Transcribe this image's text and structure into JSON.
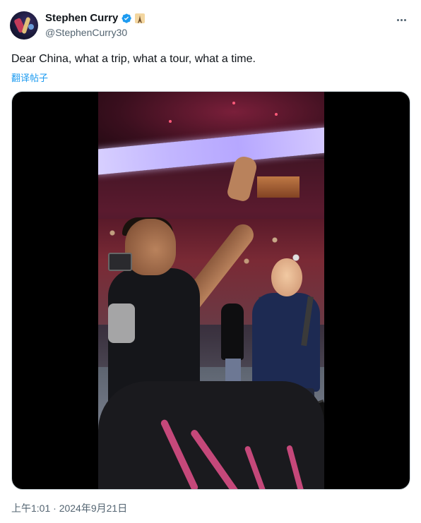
{
  "author": {
    "display_name": "Stephen Curry",
    "handle": "@StephenCurry30",
    "verified": true,
    "badge": "eiffel-tower-emoji"
  },
  "tweet": {
    "text": "Dear China, what a trip, what a tour, what a time.",
    "translate_label": "翻译帖子",
    "timestamp": "上午1:01 · 2024年9月21日"
  },
  "media": {
    "type": "video"
  },
  "colors": {
    "accent": "#1d9bf0",
    "text_primary": "#0f1419",
    "text_secondary": "#536471",
    "media_background": "#000000"
  },
  "icons": {
    "verified": "verified-badge-icon",
    "more": "more-horizontal-icon",
    "badge": "eiffel-tower-icon"
  }
}
